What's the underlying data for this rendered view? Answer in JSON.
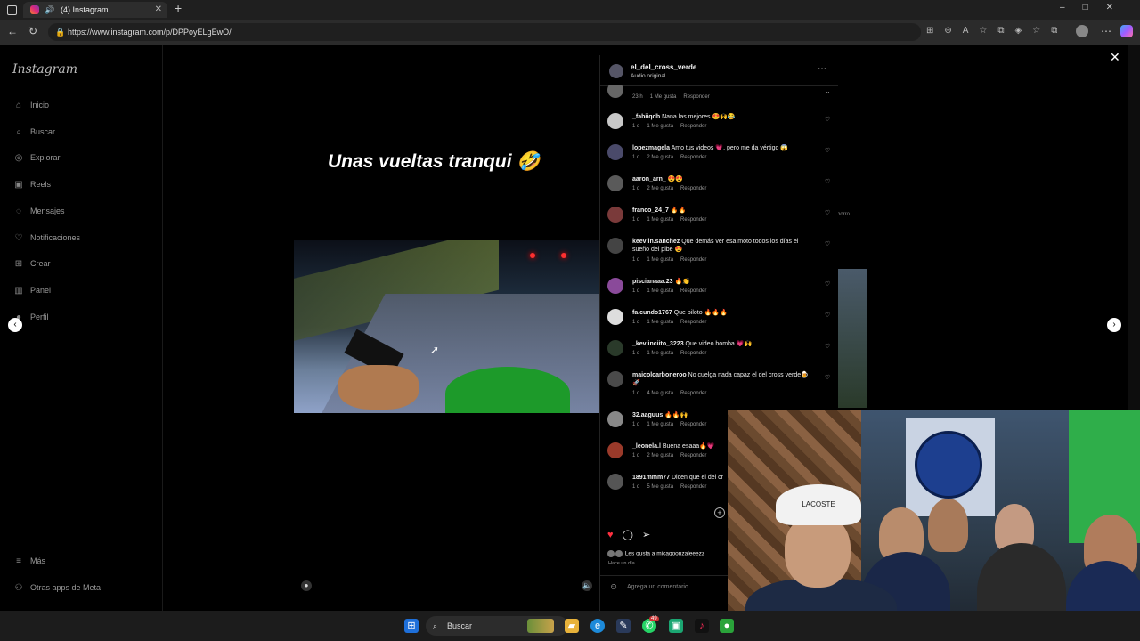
{
  "browser": {
    "tab_title": "(4) Instagram",
    "url": "https://www.instagram.com/p/DPPoyELgEwO/"
  },
  "sidebar": {
    "logo": "Instagram",
    "items": [
      {
        "label": "Inicio",
        "icon": "home-icon",
        "glyph": "⌂"
      },
      {
        "label": "Buscar",
        "icon": "search-icon",
        "glyph": "⌕"
      },
      {
        "label": "Explorar",
        "icon": "compass-icon",
        "glyph": "◎"
      },
      {
        "label": "Reels",
        "icon": "reels-icon",
        "glyph": "▣"
      },
      {
        "label": "Mensajes",
        "icon": "messenger-icon",
        "glyph": "◌"
      },
      {
        "label": "Notificaciones",
        "icon": "heart-icon",
        "glyph": "♡"
      },
      {
        "label": "Crear",
        "icon": "plus-square-icon",
        "glyph": "⊞"
      },
      {
        "label": "Panel",
        "icon": "dashboard-icon",
        "glyph": "▥"
      },
      {
        "label": "Perfil",
        "icon": "profile-icon",
        "glyph": "●"
      }
    ],
    "more": "Más",
    "meta_apps": "Otras apps de Meta"
  },
  "post": {
    "caption": "Unas vueltas tranqui 🤣",
    "username": "el_del_cross_verde",
    "audio": "Audio original",
    "liked_by": "Les gusta a micagoonzaleeezz_",
    "time_ago": "Hace un día",
    "add_comment_placeholder": "Agrega un comentario..."
  },
  "comments": [
    {
      "user": "",
      "text": "",
      "time": "23 h",
      "likes": "1 Me gusta",
      "reply": "Responder"
    },
    {
      "user": "_fabiiqdb",
      "text": "Nana las mejores 😍🙌😂",
      "time": "1 d",
      "likes": "1 Me gusta",
      "reply": "Responder"
    },
    {
      "user": "lopezmagela",
      "text": "Amo tus videos 💗, pero me da vértigo 😱",
      "time": "1 d",
      "likes": "2 Me gusta",
      "reply": "Responder"
    },
    {
      "user": "aaron_arn_",
      "text": "😍😍",
      "time": "1 d",
      "likes": "2 Me gusta",
      "reply": "Responder"
    },
    {
      "user": "franco_24_7",
      "text": "🔥🔥",
      "time": "1 d",
      "likes": "1 Me gusta",
      "reply": "Responder"
    },
    {
      "user": "keeviin.sanchez",
      "text": "Que demás ver esa moto todos los días el sueño del pibe 😍",
      "time": "1 d",
      "likes": "1 Me gusta",
      "reply": "Responder"
    },
    {
      "user": "piscianaaa.23",
      "text": "🔥👏",
      "time": "1 d",
      "likes": "1 Me gusta",
      "reply": "Responder"
    },
    {
      "user": "fa.cundo1767",
      "text": "Que piloto 🔥🔥🔥",
      "time": "1 d",
      "likes": "1 Me gusta",
      "reply": "Responder"
    },
    {
      "user": "_keviinciito_3223",
      "text": "Que video bomba 💗🙌",
      "time": "1 d",
      "likes": "1 Me gusta",
      "reply": "Responder"
    },
    {
      "user": "maicolcarboneroo",
      "text": "No cuelga nada capaz el del cross verde🍺🚀",
      "time": "1 d",
      "likes": "4 Me gusta",
      "reply": "Responder"
    },
    {
      "user": "32.aaguus",
      "text": "🔥🔥🙌",
      "time": "1 d",
      "likes": "1 Me gusta",
      "reply": "Responder"
    },
    {
      "user": "_leonela.l",
      "text": "Buena esaaa🔥💗",
      "time": "1 d",
      "likes": "2 Me gusta",
      "reply": "Responder"
    },
    {
      "user": "1891mmm77",
      "text": "Dicen que el del cr",
      "time": "1 d",
      "likes": "5 Me gusta",
      "reply": "Responder"
    }
  ],
  "peek_label": "borro",
  "webcam": {
    "cap_text": "LACOSTE"
  },
  "taskbar": {
    "search_label": "Buscar",
    "badge": "49"
  }
}
